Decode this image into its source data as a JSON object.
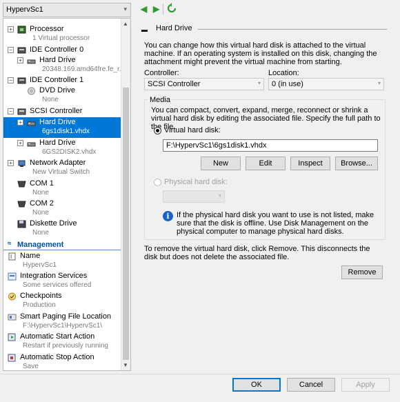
{
  "vm_selector": {
    "value": "HypervSc1"
  },
  "toolbar": {
    "back_icon": "back-arrow-icon",
    "forward_icon": "forward-arrow-icon",
    "refresh_icon": "refresh-icon"
  },
  "tree": {
    "hardware": [
      {
        "name": "Processor",
        "sub": "1 Virtual processor",
        "icon": "processor-icon",
        "expander": "+"
      },
      {
        "name": "IDE Controller 0",
        "sub": "",
        "icon": "ide-controller-icon",
        "expander": "−"
      },
      {
        "name": "Hard Drive",
        "sub": "20348.169.amd64fre.fe_r...",
        "icon": "hard-drive-icon",
        "expander": "+"
      },
      {
        "name": "IDE Controller 1",
        "sub": "",
        "icon": "ide-controller-icon",
        "expander": "−"
      },
      {
        "name": "DVD Drive",
        "sub": "None",
        "icon": "dvd-drive-icon",
        "expander": ""
      },
      {
        "name": "SCSI Controller",
        "sub": "",
        "icon": "scsi-controller-icon",
        "expander": "−"
      },
      {
        "name": "Hard Drive",
        "sub": "6gs1disk1.vhdx",
        "icon": "hard-drive-icon",
        "expander": "+"
      },
      {
        "name": "Hard Drive",
        "sub": "6GS2DISK2.vhdx",
        "icon": "hard-drive-icon",
        "expander": "+"
      },
      {
        "name": "Network Adapter",
        "sub": "New Virtual Switch",
        "icon": "network-adapter-icon",
        "expander": "+"
      },
      {
        "name": "COM 1",
        "sub": "None",
        "icon": "com-port-icon",
        "expander": ""
      },
      {
        "name": "COM 2",
        "sub": "None",
        "icon": "com-port-icon",
        "expander": ""
      },
      {
        "name": "Diskette Drive",
        "sub": "None",
        "icon": "diskette-drive-icon",
        "expander": ""
      }
    ],
    "management_title": "Management",
    "management": [
      {
        "name": "Name",
        "sub": "HypervSc1",
        "icon": "name-icon"
      },
      {
        "name": "Integration Services",
        "sub": "Some services offered",
        "icon": "integration-services-icon"
      },
      {
        "name": "Checkpoints",
        "sub": "Production",
        "icon": "checkpoints-icon"
      },
      {
        "name": "Smart Paging File Location",
        "sub": "F:\\HypervSc1\\HypervSc1\\",
        "icon": "smart-paging-icon"
      },
      {
        "name": "Automatic Start Action",
        "sub": "Restart if previously running",
        "icon": "automatic-start-icon"
      },
      {
        "name": "Automatic Stop Action",
        "sub": "Save",
        "icon": "automatic-stop-icon"
      }
    ]
  },
  "detail": {
    "section_title": "Hard Drive",
    "intro": "You can change how this virtual hard disk is attached to the virtual machine. If an operating system is installed on this disk, changing the attachment might prevent the virtual machine from starting.",
    "controller_label": "Controller:",
    "controller_value": "SCSI Controller",
    "location_label": "Location:",
    "location_value": "0 (in use)",
    "media_label": "Media",
    "media_desc": "You can compact, convert, expand, merge, reconnect or shrink a virtual hard disk by editing the associated file. Specify the full path to the file.",
    "virtual_hd_label": "Virtual hard disk:",
    "virtual_hd_path": "F:\\HypervSc1\\6gs1disk1.vhdx",
    "buttons": {
      "new": "New",
      "edit": "Edit",
      "inspect": "Inspect",
      "browse": "Browse..."
    },
    "physical_hd_label": "Physical hard disk:",
    "physical_info": "If the physical hard disk you want to use is not listed, make sure that the disk is offline. Use Disk Management on the physical computer to manage physical hard disks.",
    "remove_text": "To remove the virtual hard disk, click Remove. This disconnects the disk but does not delete the associated file.",
    "remove_button": "Remove"
  },
  "dialog_buttons": {
    "ok": "OK",
    "cancel": "Cancel",
    "apply": "Apply"
  },
  "colors": {
    "selection": "#0078d7",
    "accent": "#0050a0"
  }
}
